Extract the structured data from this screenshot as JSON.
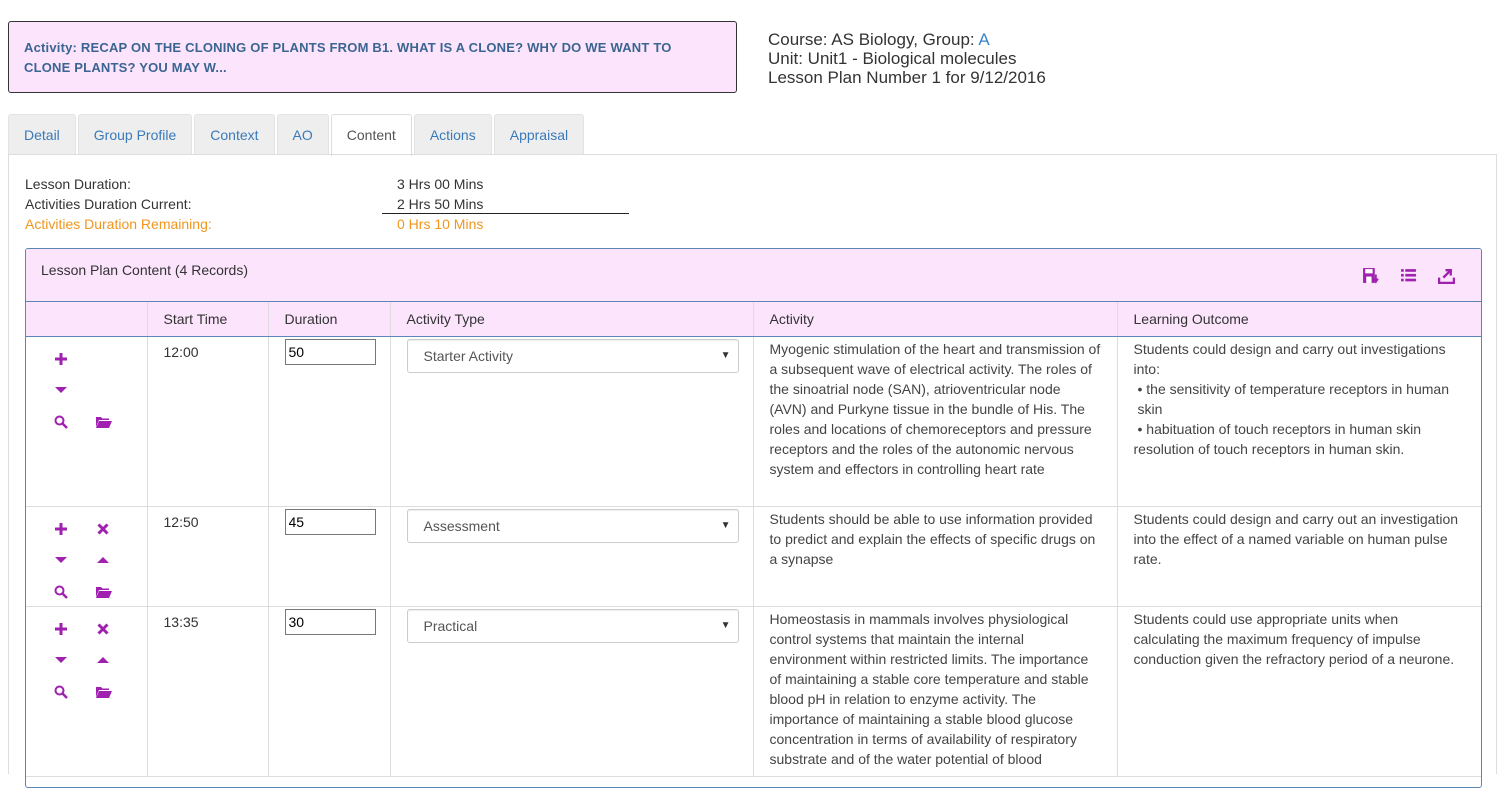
{
  "activity_banner": "Activity: RECAP ON THE CLONING OF PLANTS FROM B1. WHAT IS A CLONE? WHY DO WE WANT TO CLONE PLANTS? YOU MAY W...",
  "course": {
    "course_prefix": "Course: AS Biology, Group: ",
    "group": "A",
    "unit": "Unit: Unit1 - Biological molecules",
    "lesson": "Lesson Plan Number 1 for 9/12/2016"
  },
  "tabs": [
    "Detail",
    "Group Profile",
    "Context",
    "AO",
    "Content",
    "Actions",
    "Appraisal"
  ],
  "active_tab": "Content",
  "durations": {
    "lesson_label": "Lesson Duration:",
    "lesson_value": "3 Hrs 00 Mins",
    "current_label": "Activities Duration Current:",
    "current_value": "2 Hrs 50 Mins",
    "remaining_label": "Activities Duration Remaining:",
    "remaining_value": "0 Hrs 10 Mins"
  },
  "grid": {
    "title": "Lesson Plan Content (4 Records)",
    "tools": [
      "save-icon",
      "list-icon",
      "export-icon"
    ],
    "columns": [
      "",
      "Start Time",
      "Duration",
      "Activity Type",
      "Activity",
      "Learning Outcome"
    ],
    "rows": [
      {
        "start": "12:00",
        "duration": "50",
        "type": "Starter Activity",
        "activity": "Myogenic stimulation of the heart and transmission of a subsequent wave of electrical activity. The roles of the sinoatrial node (SAN), atrioventricular node (AVN) and Purkyne tissue in the bundle of His. The roles and locations of chemoreceptors and pressure receptors and the roles of the autonomic nervous system and effectors in controlling heart rate",
        "outcome_intro": "Students could design and carry out investigations into:",
        "outcome_b1": "• the sensitivity of temperature receptors in human skin",
        "outcome_b2": "• habituation of touch receptors in human skin",
        "outcome_tail": "resolution of touch receptors in human skin."
      },
      {
        "start": "12:50",
        "duration": "45",
        "type": "Assessment",
        "activity": "Students should be able to use information provided to predict and explain the effects of specific drugs on a synapse",
        "outcome": "Students could design and carry out an investigation into the effect of a named variable on human pulse rate."
      },
      {
        "start": "13:35",
        "duration": "30",
        "type": "Practical",
        "activity": "Homeostasis in mammals involves physiological control systems that maintain the internal environment within restricted limits. The importance of maintaining a stable core temperature and stable blood pH in relation to enzyme activity. The importance of maintaining a stable blood glucose concentration in terms of availability of respiratory substrate and of the water potential of blood",
        "outcome": "Students could use appropriate units when calculating the maximum frequency of impulse conduction given the refractory period of a neurone."
      }
    ]
  },
  "colors": {
    "accent": "#a020b0",
    "banner_bg": "#fce4fc",
    "link": "#3a7ab8",
    "warning": "#f0961e"
  }
}
